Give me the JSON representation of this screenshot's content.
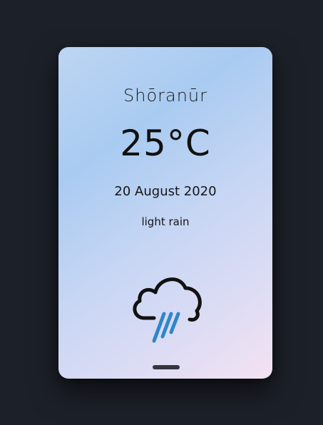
{
  "weather": {
    "city": "Shōranūr",
    "temperature": "25°C",
    "date": "20 August 2020",
    "description": "light rain",
    "icon": "cloud-rain-icon"
  },
  "colors": {
    "page_background": "#1c2028",
    "rain_accent": "#2f86c9",
    "icon_outline": "#111111"
  }
}
